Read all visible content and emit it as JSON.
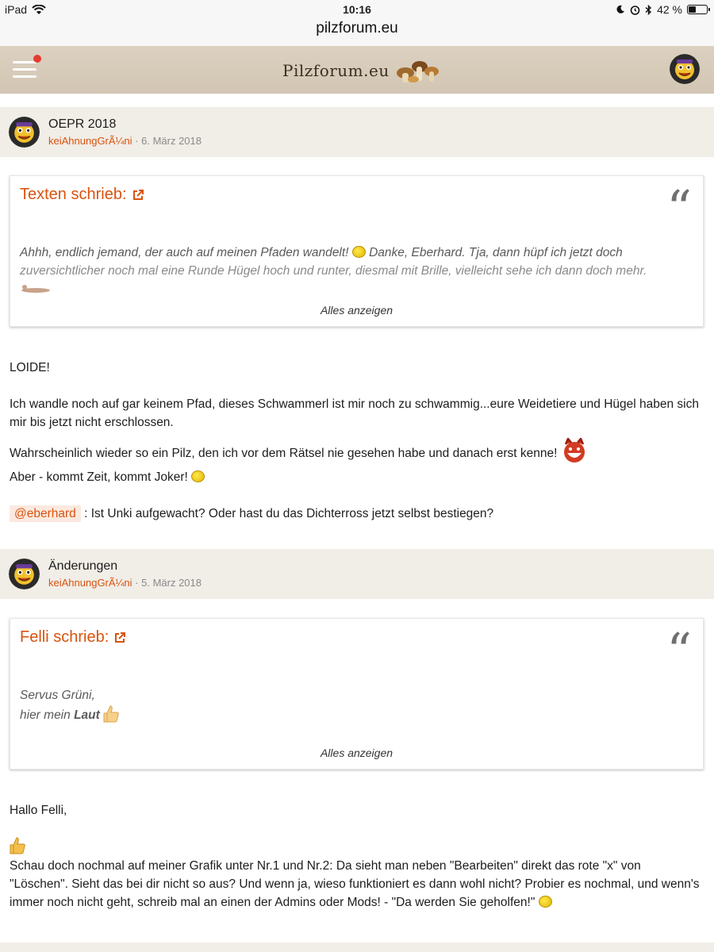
{
  "status": {
    "carrier": "iPad",
    "time": "10:16",
    "battery": "42 %",
    "battery_fraction": 0.42
  },
  "url": "pilzforum.eu",
  "header": {
    "logo_text": "Pilzforum.eu"
  },
  "posts": [
    {
      "title": "OEPR 2018",
      "author": "keiAhnungGrÃ¼ni",
      "separator": "·",
      "date": "6. März 2018",
      "quote": {
        "title": "Texten schrieb:",
        "text": "Ahhh, endlich jemand, der auch auf meinen Pfaden wandelt!",
        "text2": "Danke, Eberhard. Tja, dann hüpf ich jetzt doch",
        "text3": "zuversichtlicher noch mal eine Runde Hügel hoch und runter, diesmal mit Brille, vielleicht sehe ich dann doch mehr.",
        "show_all": "Alles anzeigen"
      },
      "body": {
        "p1": "LOIDE!",
        "p2": "Ich wandle noch auf gar keinem Pfad, dieses Schwammerl ist mir noch zu schwammig...eure Weidetiere und Hügel haben sich mir bis jetzt nicht erschlossen.",
        "p3": "Wahrscheinlich wieder so ein Pilz, den ich vor dem Rätsel nie gesehen habe und danach erst kenne!",
        "p4": "Aber - kommt Zeit, kommt Joker!",
        "mention": "@eberhard",
        "p5": ": Ist Unki aufgewacht? Oder hast du das Dichterross jetzt selbst bestiegen?"
      }
    },
    {
      "title": "Änderungen",
      "author": "keiAhnungGrÃ¼ni",
      "separator": "·",
      "date": "5. März 2018",
      "quote": {
        "title": "Felli schrieb:",
        "line1": "Servus Grüni,",
        "line2": "hier mein",
        "line2_bold": "Laut",
        "show_all": "Alles anzeigen"
      },
      "body": {
        "p1": "Hallo Felli,",
        "p2": "Schau doch nochmal auf meiner Grafik unter Nr.1 und Nr.2: Da sieht man neben \"Bearbeiten\" direkt das rote \"x\" von \"Löschen\". Sieht das bei dir nicht so aus? Und wenn ja, wieso funktioniert es dann wohl nicht? Probier es nochmal, und wenn's immer noch nicht geht, schreib mal an einen der Admins oder Mods! - \"Da werden Sie geholfen!\""
      }
    }
  ],
  "icons": {
    "wifi": "wifi-icon",
    "moon": "moon-icon",
    "alarm": "alarm-icon",
    "bluetooth": "bluetooth-icon",
    "menu": "hamburger-menu-icon",
    "external": "external-link-icon",
    "quote": "quote-mark-icon"
  },
  "colors": {
    "accent": "#d9530e",
    "header_bg": "#d6cab9",
    "post_head_bg": "#f1ede7",
    "notification": "#e53b30"
  }
}
